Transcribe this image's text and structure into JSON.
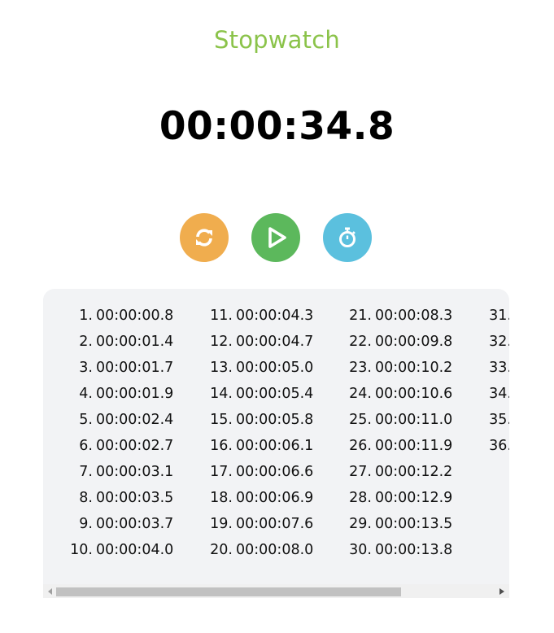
{
  "title": "Stopwatch",
  "time_display": "00:00:34.8",
  "controls": {
    "reset_icon": "refresh-icon",
    "play_icon": "play-icon",
    "lap_icon": "stopwatch-icon",
    "reset_color": "#f0ad4e",
    "play_color": "#5cb85c",
    "lap_color": "#5bc0de"
  },
  "laps": [
    {
      "num": "1.",
      "time": "00:00:00.8"
    },
    {
      "num": "2.",
      "time": "00:00:01.4"
    },
    {
      "num": "3.",
      "time": "00:00:01.7"
    },
    {
      "num": "4.",
      "time": "00:00:01.9"
    },
    {
      "num": "5.",
      "time": "00:00:02.4"
    },
    {
      "num": "6.",
      "time": "00:00:02.7"
    },
    {
      "num": "7.",
      "time": "00:00:03.1"
    },
    {
      "num": "8.",
      "time": "00:00:03.5"
    },
    {
      "num": "9.",
      "time": "00:00:03.7"
    },
    {
      "num": "10.",
      "time": "00:00:04.0"
    },
    {
      "num": "11.",
      "time": "00:00:04.3"
    },
    {
      "num": "12.",
      "time": "00:00:04.7"
    },
    {
      "num": "13.",
      "time": "00:00:05.0"
    },
    {
      "num": "14.",
      "time": "00:00:05.4"
    },
    {
      "num": "15.",
      "time": "00:00:05.8"
    },
    {
      "num": "16.",
      "time": "00:00:06.1"
    },
    {
      "num": "17.",
      "time": "00:00:06.6"
    },
    {
      "num": "18.",
      "time": "00:00:06.9"
    },
    {
      "num": "19.",
      "time": "00:00:07.6"
    },
    {
      "num": "20.",
      "time": "00:00:08.0"
    },
    {
      "num": "21.",
      "time": "00:00:08.3"
    },
    {
      "num": "22.",
      "time": "00:00:09.8"
    },
    {
      "num": "23.",
      "time": "00:00:10.2"
    },
    {
      "num": "24.",
      "time": "00:00:10.6"
    },
    {
      "num": "25.",
      "time": "00:00:11.0"
    },
    {
      "num": "26.",
      "time": "00:00:11.9"
    },
    {
      "num": "27.",
      "time": "00:00:12.2"
    },
    {
      "num": "28.",
      "time": "00:00:12.9"
    },
    {
      "num": "29.",
      "time": "00:00:13.5"
    },
    {
      "num": "30.",
      "time": "00:00:13.8"
    },
    {
      "num": "31.",
      "time": ""
    },
    {
      "num": "32.",
      "time": ""
    },
    {
      "num": "33.",
      "time": ""
    },
    {
      "num": "34.",
      "time": ""
    },
    {
      "num": "35.",
      "time": ""
    },
    {
      "num": "36.",
      "time": ""
    }
  ]
}
